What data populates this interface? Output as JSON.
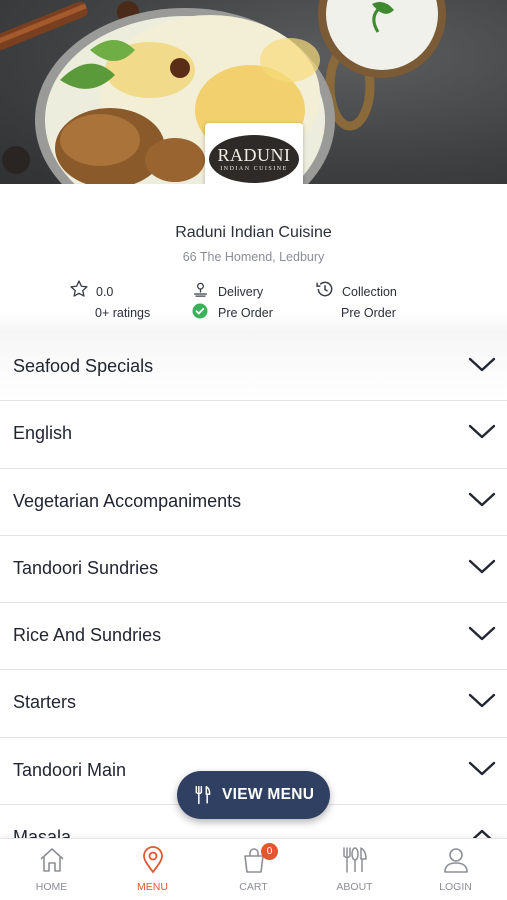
{
  "restaurant": {
    "logo_name": "RADUNI",
    "logo_sub": "INDIAN CUISINE",
    "name": "Raduni Indian Cuisine",
    "address": "66 The Homend, Ledbury"
  },
  "stats": {
    "rating_value": "0.0",
    "rating_count": "0+ ratings",
    "delivery_label": "Delivery",
    "delivery_mode": "Pre Order",
    "collection_label": "Collection",
    "collection_mode": "Pre Order"
  },
  "categories": [
    {
      "label": "Seafood Specials",
      "expanded": false
    },
    {
      "label": "English",
      "expanded": false
    },
    {
      "label": "Vegetarian Accompaniments",
      "expanded": false
    },
    {
      "label": "Tandoori Sundries",
      "expanded": false
    },
    {
      "label": "Rice And Sundries",
      "expanded": false
    },
    {
      "label": "Starters",
      "expanded": false
    },
    {
      "label": "Tandoori Main",
      "expanded": false
    },
    {
      "label": "Masala",
      "expanded": true
    }
  ],
  "view_menu_label": "VIEW MENU",
  "tabbar": {
    "home": "HOME",
    "menu": "MENU",
    "cart": "CART",
    "cart_count": "0",
    "about": "ABOUT",
    "login": "LOGIN",
    "active": "menu"
  },
  "colors": {
    "accent": "#e2572f",
    "button_bg": "#2f4063",
    "success": "#3bb15a",
    "text": "#222633",
    "muted": "#8b8e96"
  }
}
